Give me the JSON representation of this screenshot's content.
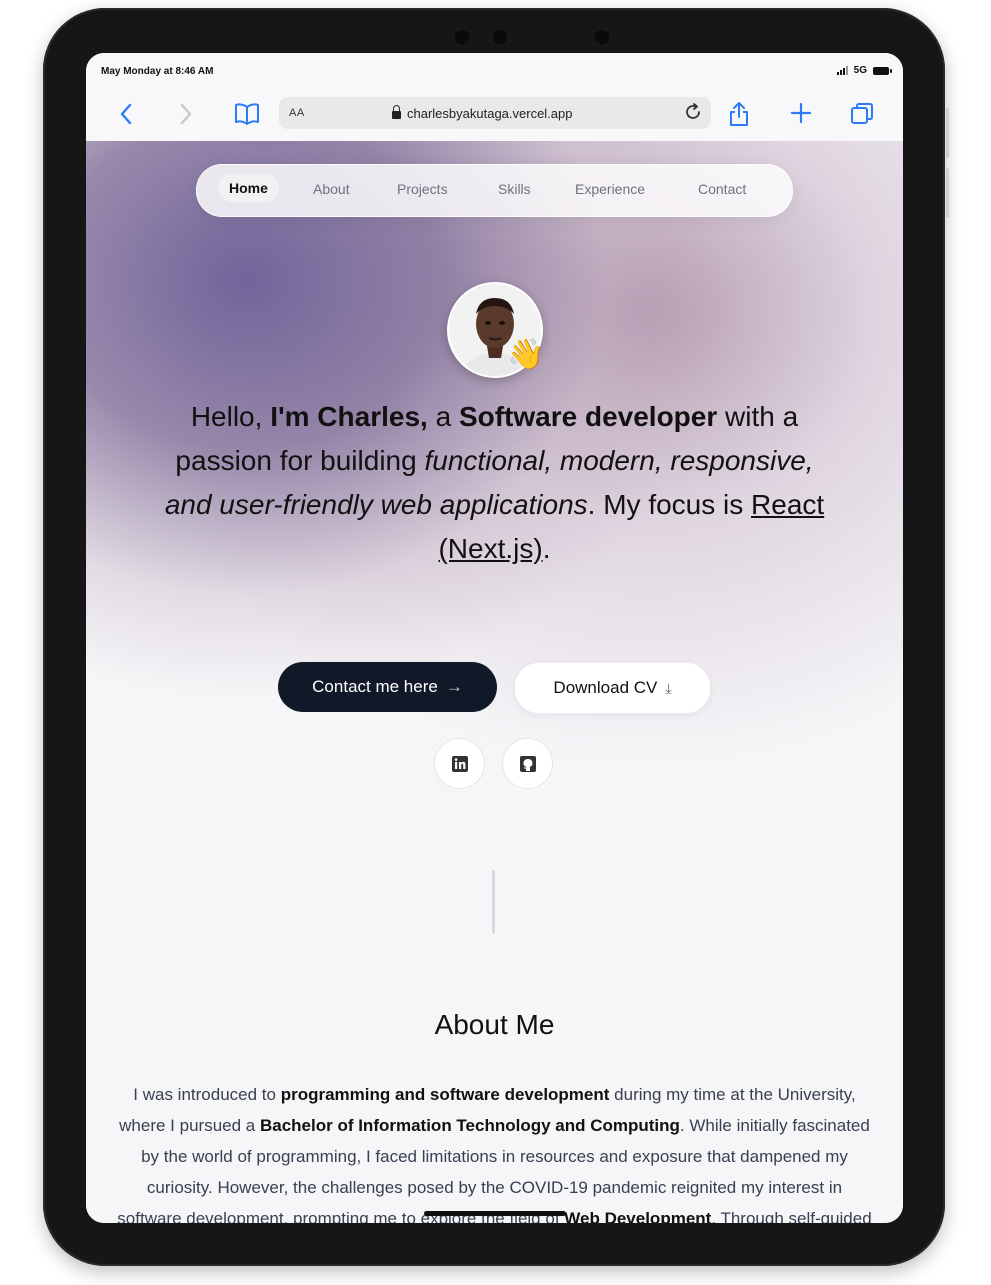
{
  "status_bar": {
    "time": "May Monday at 8:46 AM",
    "network": "5G"
  },
  "browser": {
    "text_size_label": "AA",
    "url": "charlesbyakutaga.vercel.app",
    "icons": [
      "back-icon",
      "forward-icon",
      "bookmarks-icon",
      "reload-icon",
      "share-icon",
      "new-tab-icon",
      "tabs-icon"
    ]
  },
  "nav": {
    "items": [
      {
        "label": "Home",
        "active": true
      },
      {
        "label": "About"
      },
      {
        "label": "Projects"
      },
      {
        "label": "Skills"
      },
      {
        "label": "Experience"
      },
      {
        "label": "Contact"
      }
    ]
  },
  "hero": {
    "greeting": "Hello, ",
    "name": "I'm Charles,",
    "a": " a ",
    "role": "Software developer",
    "mid": " with a passion for building ",
    "qualities": "functional, modern, responsive, and user-friendly web applications",
    "dot": ".",
    "focus_prefix": " My focus is ",
    "focus": "React (Next.js)",
    "end": ".",
    "wave_emoji": "👋"
  },
  "buttons": {
    "contact": "Contact me here",
    "contact_arrow": "→",
    "cv": "Download CV",
    "cv_icon": "⤓"
  },
  "social": [
    "linkedin-icon",
    "github-icon"
  ],
  "about": {
    "title": "About Me",
    "p1": "I was introduced to ",
    "b1": "programming and software development",
    "p2": " during my time at the University, where I pursued a ",
    "b2": "Bachelor of Information Technology and Computing",
    "p3": ". While initially fascinated by the world of programming, I faced limitations in resources and exposure that dampened my curiosity. However, the challenges posed by the COVID-19 pandemic reignited my interest in software development, prompting me to explore the field of ",
    "b3": "Web Development",
    "p4": ". Through self-guided learning via YouTube tutorials and formal"
  },
  "colors": {
    "accent": "#2b7cf6",
    "dark_button": "#111827",
    "hero_purple": "#6a5e96"
  }
}
